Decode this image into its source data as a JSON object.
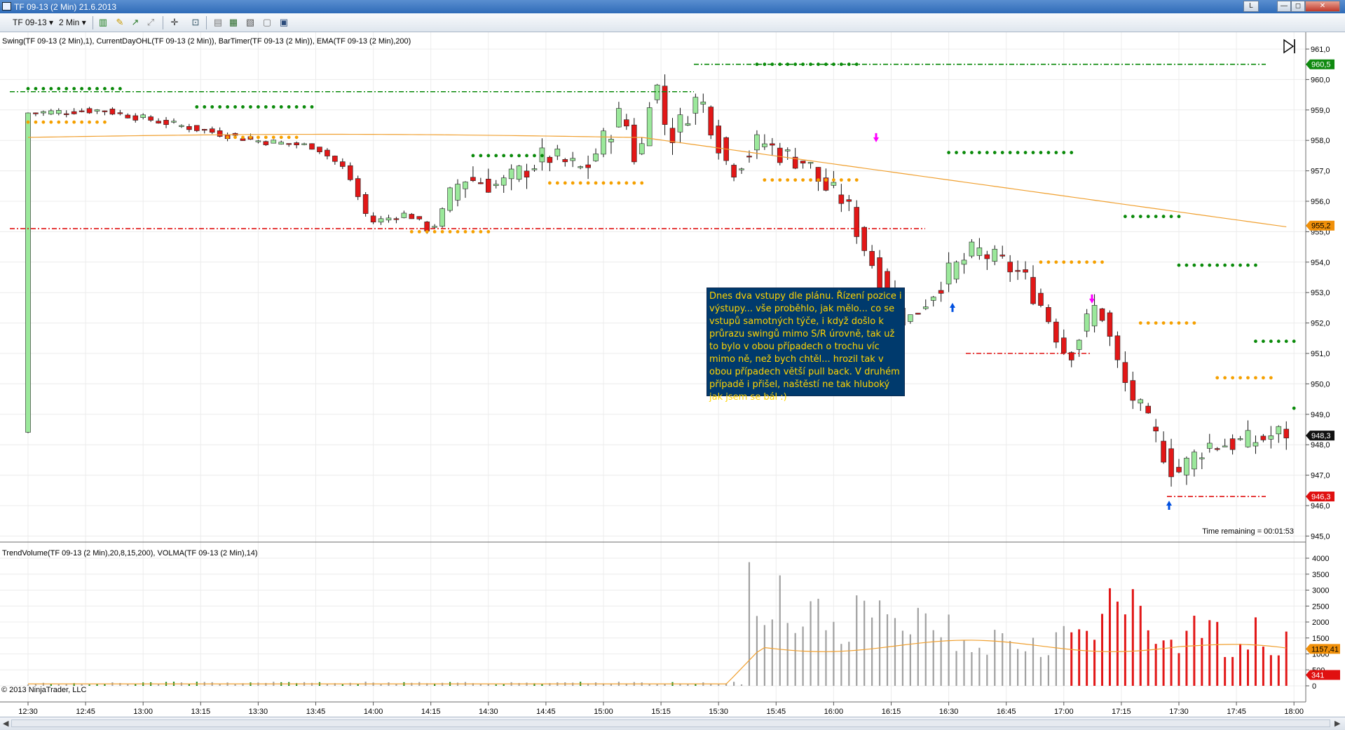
{
  "window": {
    "title": "TF 09-13 (2 Min)  21.6.2013",
    "controls": [
      "L",
      "—",
      "◻",
      "✕"
    ]
  },
  "toolbar": {
    "instrument": "TF 09-13",
    "interval": "2 Min"
  },
  "price_panel": {
    "indicators_label": "Swing(TF 09-13 (2 Min),1), CurrentDayOHL(TF 09-13 (2 Min)), BarTimer(TF 09-13 (2 Min)), EMA(TF 09-13 (2 Min),200)",
    "time_remaining": "Time remaining = 00:01:53",
    "y_ticks": [
      "961,0",
      "960,0",
      "959,0",
      "958,0",
      "957,0",
      "956,0",
      "955,0",
      "954,0",
      "953,0",
      "952,0",
      "951,0",
      "950,0",
      "949,0",
      "948,0",
      "947,0",
      "946,0",
      "945,0"
    ],
    "markers": [
      {
        "label": "960,5",
        "color": "#108a10"
      },
      {
        "label": "955,2",
        "color": "#f0900a"
      },
      {
        "label": "948,3",
        "color": "#111111"
      },
      {
        "label": "946,3",
        "color": "#e01010"
      }
    ],
    "note": "Dnes dva vstupy dle plánu. Řízení pozice i výstupy... vše proběhlo, jak mělo... co se vstupů samotných týče, i když došlo k průrazu swingů mimo S/R úrovně, tak už to bylo v obou případech o trochu víc mimo ně, než bych chtěl... hrozil tak v obou případech větší pull back. V druhém případě i přišel, naštěstí ne tak hluboký jak jsem se bál :)"
  },
  "volume_panel": {
    "indicators_label": "TrendVolume(TF 09-13 (2 Min),20,8,15,200), VOLMA(TF 09-13 (2 Min),14)",
    "y_ticks": [
      "4000",
      "3500",
      "3000",
      "2500",
      "2000",
      "1500",
      "1000",
      "500",
      "0"
    ],
    "markers": [
      {
        "label": "1157,41",
        "color": "#f0900a"
      },
      {
        "label": "341",
        "color": "#e01010"
      }
    ],
    "copyright": "© 2013 NinjaTrader, LLC"
  },
  "time_axis": {
    "labels": [
      "12:30",
      "12:45",
      "13:00",
      "13:15",
      "13:30",
      "13:45",
      "14:00",
      "14:15",
      "14:30",
      "14:45",
      "15:00",
      "15:15",
      "15:30",
      "15:45",
      "16:00",
      "16:15",
      "16:30",
      "16:45",
      "17:00",
      "17:15",
      "17:30",
      "17:45",
      "18:00"
    ]
  },
  "colors": {
    "up_candle": "#9be89b",
    "down_candle": "#e21717",
    "swing_high": "#0a8a0a",
    "swing_low": "#f5a000",
    "ema": "#f0a030",
    "day_high": "#0a8a0a",
    "day_low": "#e01010",
    "volume_neutral": "#a0a0a0",
    "volume_down": "#e21717"
  }
}
